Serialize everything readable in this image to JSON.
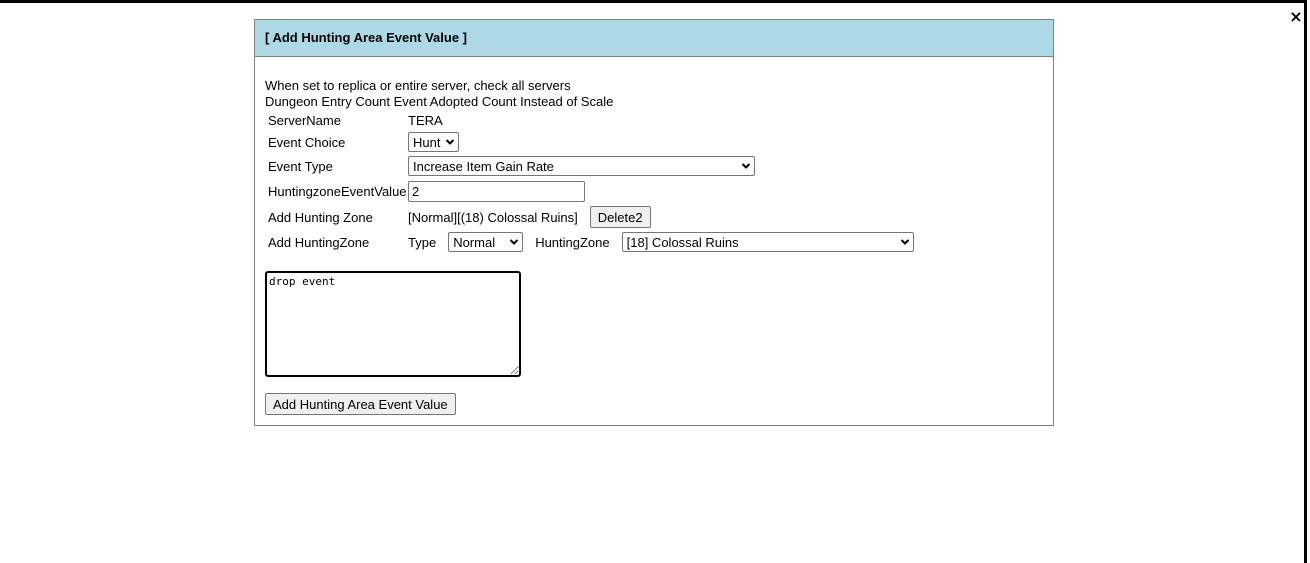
{
  "window": {
    "close_icon": "×"
  },
  "panel": {
    "title": "[ Add Hunting Area Event Value ]",
    "notes": [
      "When set to replica or entire server, check all servers",
      "Dungeon Entry Count Event Adopted Count Instead of Scale"
    ],
    "server_name": {
      "label": "ServerName",
      "value": "TERA"
    },
    "event_choice": {
      "label": "Event Choice",
      "selected": "Hunt"
    },
    "event_type": {
      "label": "Event Type",
      "selected": "Increase Item Gain Rate"
    },
    "event_value": {
      "label": "HuntingzoneEventValue",
      "value": "2"
    },
    "added_zone": {
      "label": "Add Hunting Zone",
      "value": "[Normal][(18) Colossal Ruins]",
      "delete_label": "Delete2"
    },
    "add_zone": {
      "label": "Add HuntingZone",
      "type_label": "Type",
      "type_selected": "Normal",
      "zone_label": "HuntingZone",
      "zone_selected": "[18] Colossal Ruins"
    },
    "memo": {
      "value": "drop event"
    },
    "submit_label": "Add Hunting Area Event Value"
  },
  "colors": {
    "header_bg": "#add8e6",
    "panel_border": "#808080"
  }
}
